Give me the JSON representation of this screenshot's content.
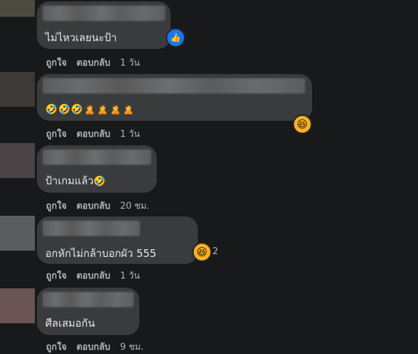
{
  "comments": [
    {
      "text": "ไม่ไหวเลยนะป้า",
      "emojis": [],
      "reaction": "like-icon",
      "reaction_count": "",
      "actions": {
        "like": "ถูกใจ",
        "reply": "ตอบกลับ",
        "time": "1 วัน"
      }
    },
    {
      "text": "",
      "emojis": [
        "🤣",
        "🤣",
        "🤣",
        "🙎",
        "🙎",
        "🙎",
        "🙎"
      ],
      "reaction": "haha-icon",
      "reaction_count": "",
      "actions": {
        "like": "ถูกใจ",
        "reply": "ตอบกลับ",
        "time": "1 วัน"
      }
    },
    {
      "text": "ป้าเกมแล้ว",
      "emojis": [
        "🤣"
      ],
      "reaction": "",
      "reaction_count": "",
      "actions": {
        "like": "ถูกใจ",
        "reply": "ตอบกลับ",
        "time": "20 ชม."
      }
    },
    {
      "text": "อกหักไม่กล้าบอกผัว 555",
      "emojis": [],
      "reaction": "haha-icon",
      "reaction_count": "2",
      "actions": {
        "like": "ถูกใจ",
        "reply": "ตอบกลับ",
        "time": "1 วัน"
      }
    },
    {
      "text": "ศีลเสมอกัน",
      "emojis": [],
      "reaction": "",
      "reaction_count": "",
      "actions": {
        "like": "ถูกใจ",
        "reply": "ตอบกลับ",
        "time": "9 ชม."
      }
    }
  ],
  "colors": {
    "background": "#18191a",
    "bubble": "#3a3b3c",
    "action_text": "#b0b3b8",
    "like_blue": "#1877f2",
    "haha_yellow": "#f7b125"
  }
}
